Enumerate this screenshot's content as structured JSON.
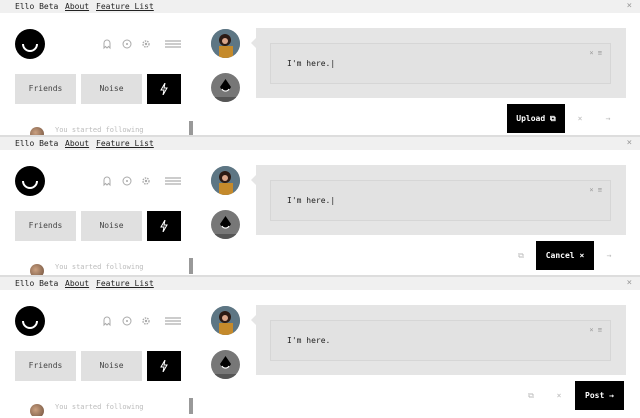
{
  "colors": {
    "accent": "#000000",
    "panel_bg": "#e5e5e5",
    "button_bg": "#e0e0e0",
    "topbar_bg": "#f0f0f0"
  },
  "panels": [
    {
      "topbar": {
        "brand": "Ello Beta",
        "links": [
          "About",
          "Feature List"
        ],
        "close_icon": "close-icon"
      },
      "toolbar": {
        "buttons": [
          "Friends",
          "Noise"
        ],
        "icons": [
          "ghost-icon",
          "clock-icon",
          "gear-icon",
          "menu-icon"
        ]
      },
      "feed": {
        "text": "You started following"
      },
      "editor": {
        "text": "I'm here.",
        "cursor": "|"
      },
      "actions": {
        "primary": "Upload",
        "secondary_icons": [
          "copy-icon",
          "close-icon",
          "arrow-right-icon"
        ]
      }
    },
    {
      "topbar": {
        "brand": "Ello Beta",
        "links": [
          "About",
          "Feature List"
        ],
        "close_icon": "close-icon"
      },
      "toolbar": {
        "buttons": [
          "Friends",
          "Noise"
        ],
        "icons": [
          "ghost-icon",
          "clock-icon",
          "gear-icon",
          "menu-icon"
        ]
      },
      "feed": {
        "text": "You started following"
      },
      "editor": {
        "text": "I'm here.",
        "cursor": "|"
      },
      "actions": {
        "primary": "Cancel",
        "secondary_icons": [
          "copy-icon",
          "close-icon",
          "arrow-right-icon"
        ]
      }
    },
    {
      "topbar": {
        "brand": "Ello Beta",
        "links": [
          "About",
          "Feature List"
        ],
        "close_icon": "close-icon"
      },
      "toolbar": {
        "buttons": [
          "Friends",
          "Noise"
        ],
        "icons": [
          "ghost-icon",
          "clock-icon",
          "gear-icon",
          "menu-icon"
        ]
      },
      "feed": {
        "text": "You started following"
      },
      "editor": {
        "text": "I'm here.",
        "cursor": ""
      },
      "actions": {
        "primary": "Post",
        "secondary_icons": [
          "copy-icon",
          "close-icon",
          "arrow-right-icon"
        ]
      }
    }
  ]
}
